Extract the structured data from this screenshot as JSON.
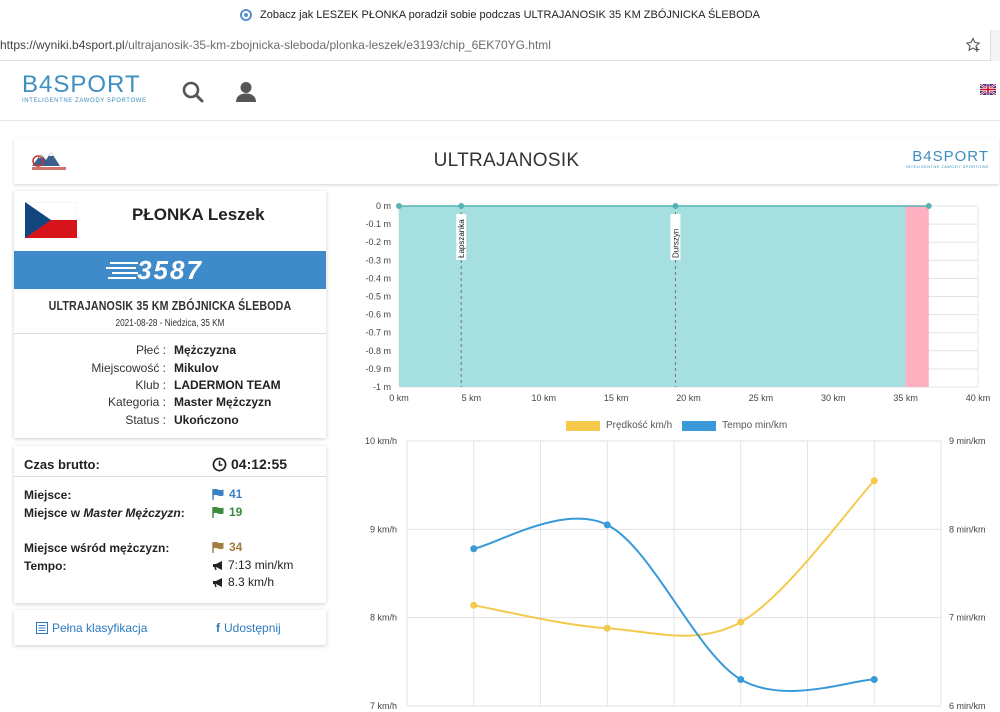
{
  "browser": {
    "title": "Zobacz jak LESZEK PŁONKA poradził sobie podczas ULTRAJANOSIK 35 KM ZBÓJNICKA ŚLEBODA",
    "url_host": "https://wyniki.b4sport.pl",
    "url_path": "/ultrajanosik-35-km-zbojnicka-sleboda/plonka-leszek/e3193/chip_6EK70YG.html"
  },
  "header": {
    "logo_text": "B4SPORT",
    "logo_tagline": "INTELIGENTNE ZAWODY SPORTOWE",
    "icons": [
      "search-icon",
      "user-icon",
      "uk-flag-icon"
    ]
  },
  "event": {
    "title": "ULTRAJANOSIK",
    "right_logo_text": "B4SPORT",
    "right_logo_tagline": "INTELIGENTNE ZAWODY SPORTOWE"
  },
  "runner": {
    "name": "PŁONKA Leszek",
    "bib": "3587",
    "race": "ULTRAJANOSIK 35 KM ZBÓJNICKA ŚLEBODA",
    "date": "2021-08-28 - Niedzica, 35 KM",
    "fields": [
      {
        "label": "Płeć :",
        "value": "Mężczyzna"
      },
      {
        "label": "Miejscowość :",
        "value": "Mikulov"
      },
      {
        "label": "Klub :",
        "value": "LADERMON TEAM"
      },
      {
        "label": "Kategoria :",
        "value": "Master Mężczyzn"
      },
      {
        "label": "Status :",
        "value": "Ukończono"
      }
    ],
    "flag_colors": {
      "white": "#ffffff",
      "red": "#d7141a",
      "blue": "#11457e"
    }
  },
  "result": {
    "time_label": "Czas brutto:",
    "time_value": "04:12:55",
    "place_label": "Miejsce:",
    "place_value": "41",
    "cat_label_1": "Miejsce w ",
    "cat_label_2": "Master Mężczyzn",
    "cat_label_3": ":",
    "cat_value": "19",
    "gender_label": "Miejsce wśród mężczyzn:",
    "gender_value": "34",
    "pace_label": "Tempo:",
    "pace_value": "7:13 min/km",
    "speed_value": "8.3 km/h",
    "colors": {
      "place": "#3b7fc4",
      "category": "#3c8a3c",
      "gender": "#a07d43"
    }
  },
  "links": {
    "classification": "Pełna klasyfikacja",
    "share": "Udostępnij"
  },
  "chart_data": [
    {
      "type": "area",
      "x_unit": "km",
      "y_unit": "m",
      "x_ticks": [
        "0 km",
        "5 km",
        "10 km",
        "15 km",
        "20 km",
        "25 km",
        "30 km",
        "35 km",
        "40 km"
      ],
      "y_ticks": [
        "0 m",
        "-0.1 m",
        "-0.2 m",
        "-0.3 m",
        "-0.4 m",
        "-0.5 m",
        "-0.6 m",
        "-0.7 m",
        "-0.8 m",
        "-0.9 m",
        "-1 m"
      ],
      "xlim": [
        0,
        40
      ],
      "ylim": [
        -1,
        0
      ],
      "checkpoints": [
        {
          "name": "Łapszanka",
          "km": 4.3
        },
        {
          "name": "Durszyn",
          "km": 19.1
        }
      ],
      "profile_end_km": 35,
      "overflow_end_km": 36.6,
      "points_km": [
        0,
        4.3,
        19.1,
        36.6
      ],
      "fill_color": "#a6dfdf",
      "overflow_color": "#ffb0c0",
      "grid": true
    },
    {
      "type": "line",
      "x": [
        1,
        2,
        3,
        4
      ],
      "series": [
        {
          "name": "Prędkość km/h",
          "axis": "left",
          "color": "#f5c94c",
          "values": [
            8.14,
            7.88,
            7.95,
            9.55
          ]
        },
        {
          "name": "Tempo min/km",
          "axis": "right",
          "color": "#3a9ad9",
          "values": [
            7.78,
            8.05,
            6.3,
            6.3
          ]
        }
      ],
      "left_ticks": [
        "10 km/h",
        "9 km/h",
        "8 km/h",
        "7 km/h"
      ],
      "right_ticks": [
        "9 min/km",
        "8 min/km",
        "7 min/km",
        "6 min/km"
      ],
      "left_ylim": [
        7,
        10
      ],
      "right_ylim": [
        6,
        9
      ],
      "legend": "top",
      "grid": true
    }
  ]
}
